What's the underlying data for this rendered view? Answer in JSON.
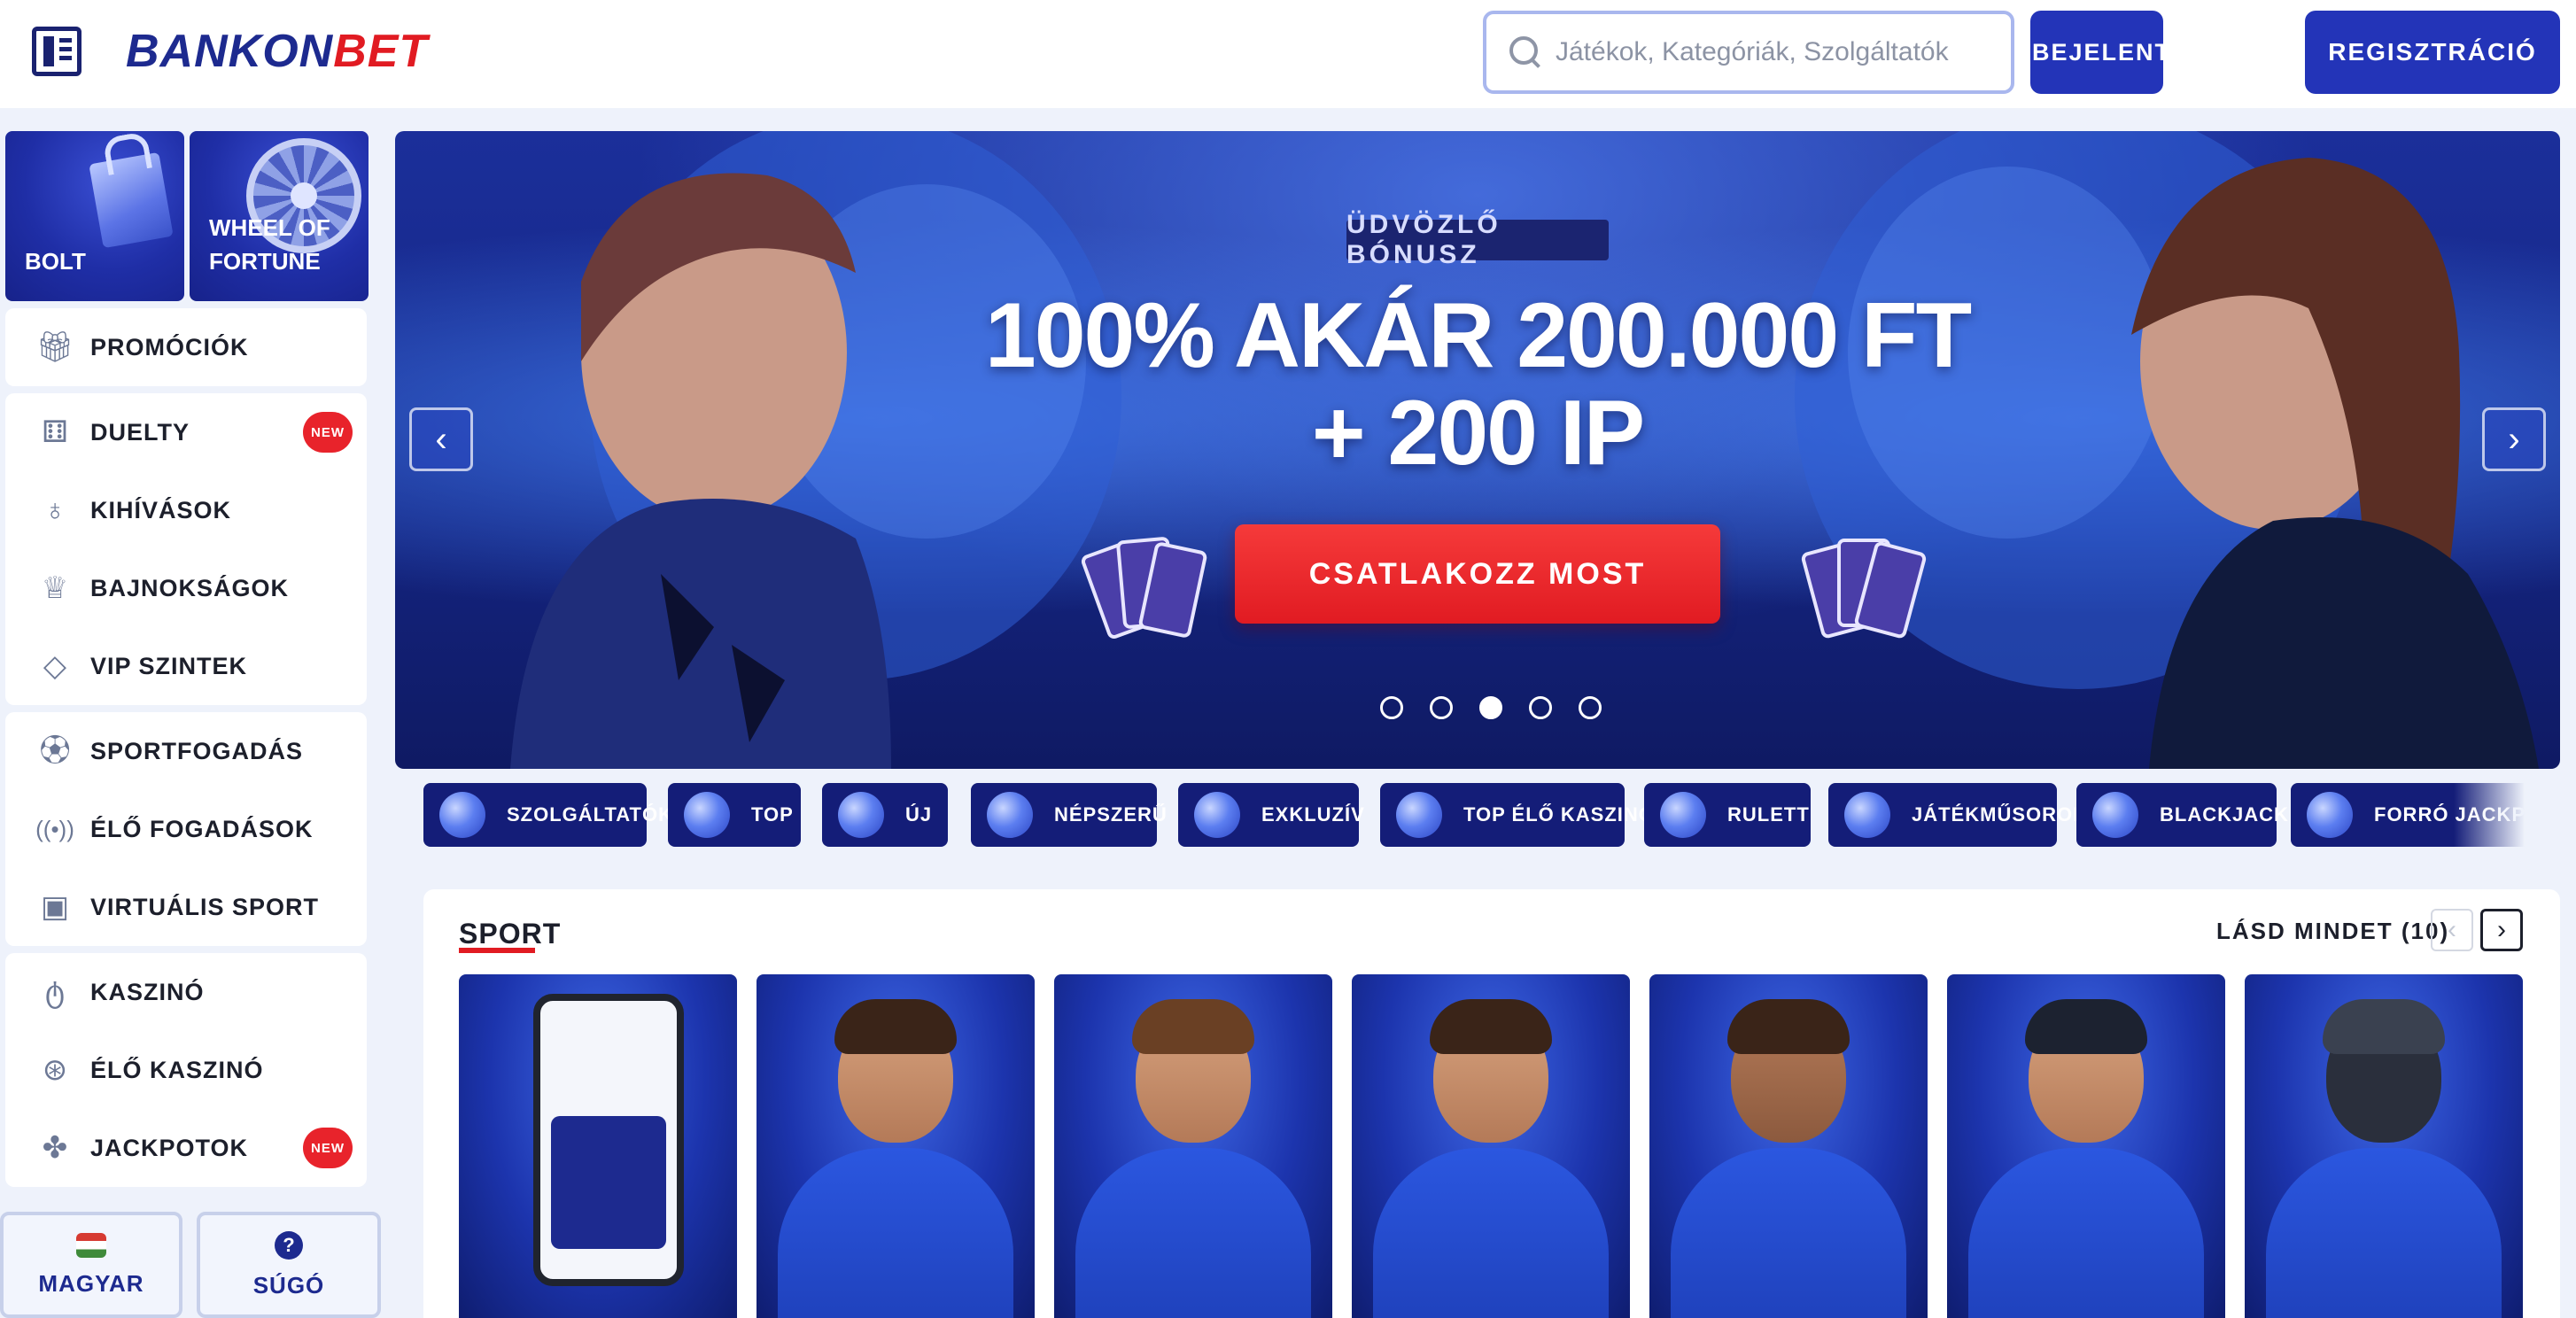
{
  "header": {
    "logo_part1": "BANKON",
    "logo_part2": "BET",
    "search_placeholder": "Játékok, Kategóriák, Szolgáltatók",
    "login_label": "BEJELENTKEZÉS",
    "register_label": "REGISZTRÁCIÓ"
  },
  "sidebar": {
    "tiles": [
      {
        "label": "BOLT",
        "icon": "shopping-bag-icon"
      },
      {
        "label": "WHEEL OF FORTUNE",
        "icon": "wheel-icon"
      }
    ],
    "items": [
      {
        "label": "PROMÓCIÓK",
        "icon": "gift-icon"
      },
      {
        "label": "DUELTY",
        "icon": "duel-icon",
        "badge": "NEW"
      },
      {
        "label": "KIHÍVÁSOK",
        "icon": "medal-icon"
      },
      {
        "label": "BAJNOKSÁGOK",
        "icon": "trophy-icon"
      },
      {
        "label": "VIP SZINTEK",
        "icon": "diamond-icon"
      },
      {
        "label": "SPORTFOGADÁS",
        "icon": "soccer-ball-icon"
      },
      {
        "label": "ÉLŐ FOGADÁSOK",
        "icon": "live-broadcast-icon"
      },
      {
        "label": "VIRTUÁLIS SPORT",
        "icon": "monitor-icon"
      },
      {
        "label": "KASZINÓ",
        "icon": "cherries-icon"
      },
      {
        "label": "ÉLŐ KASZINÓ",
        "icon": "roulette-icon"
      },
      {
        "label": "JACKPOTOK",
        "icon": "clover-icon",
        "badge": "NEW"
      }
    ],
    "footer": {
      "language_label": "MAGYAR",
      "help_label": "SÚGÓ",
      "help_glyph": "?"
    }
  },
  "hero": {
    "kicker": "ÜDVÖZLŐ BÓNUSZ",
    "title_line1": "100% AKÁR 200.000 FT",
    "title_line2": "+ 200 IP",
    "cta_label": "CSATLAKOZZ MOST",
    "slide_count": 5,
    "active_slide": 3,
    "prev_glyph": "‹",
    "next_glyph": "›"
  },
  "categories": [
    {
      "label": "SZOLGÁLTATÓK"
    },
    {
      "label": "TOP"
    },
    {
      "label": "ÚJ"
    },
    {
      "label": "NÉPSZERŰ"
    },
    {
      "label": "EXKLUZÍV"
    },
    {
      "label": "TOP ÉLŐ KASZINÓ"
    },
    {
      "label": "RULETT"
    },
    {
      "label": "JÁTÉKMŰSOROK"
    },
    {
      "label": "BLACKJACK"
    },
    {
      "label": "FORRÓ JACKPOTOK"
    }
  ],
  "sport": {
    "title": "SPORT",
    "see_all_label": "LÁSD MINDET (10)",
    "prev_glyph": "‹",
    "next_glyph": "›",
    "cards": [
      {
        "name": "sportsbook-app"
      },
      {
        "name": "football"
      },
      {
        "name": "tennis"
      },
      {
        "name": "table-tennis"
      },
      {
        "name": "basketball"
      },
      {
        "name": "ice-hockey"
      },
      {
        "name": "american-football"
      }
    ]
  },
  "colors": {
    "brand_navy": "#1d2a8f",
    "brand_red": "#e11b22",
    "button_blue": "#2334b8",
    "chip_bg": "#141d78",
    "page_bg": "#eef2fb"
  }
}
